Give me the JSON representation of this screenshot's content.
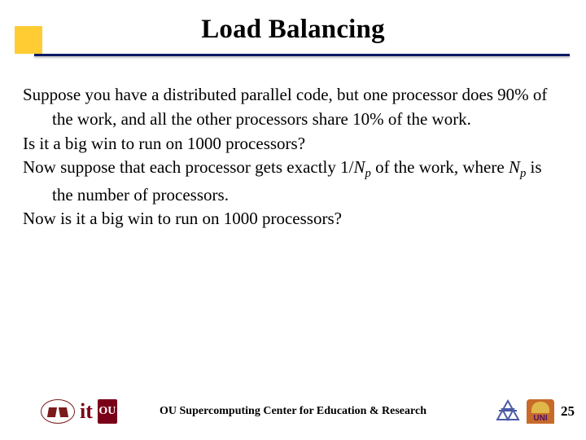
{
  "title": "Load Balancing",
  "body": {
    "p1_a": "Suppose you have a distributed parallel code, but one processor does 90% of the work, and all the other processors share 10% of the work.",
    "p2": "Is it a big win to run on 1000 processors?",
    "p3_a": "Now suppose that each processor gets exactly 1/",
    "p3_b": "N",
    "p3_c": "p",
    "p3_d": " of the work, where ",
    "p3_e": "N",
    "p3_f": "p",
    "p3_g": " is the number of processors.",
    "p4": "Now is it a big win to run on 1000 processors?"
  },
  "footer": {
    "text": "OU Supercomputing Center for Education & Research",
    "page": "25",
    "logos": {
      "carriage": "conestoga-wagon-logo",
      "it": "it",
      "ou": "OU",
      "oscer": "oscer-triangle-logo",
      "uni": "UNI"
    }
  }
}
